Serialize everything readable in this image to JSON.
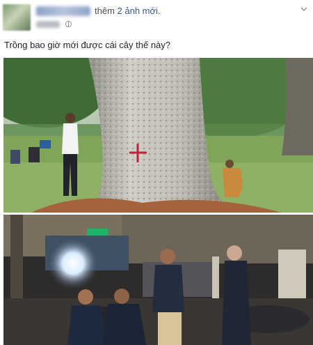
{
  "post": {
    "action_prefix": "thêm",
    "action_link": "2 ảnh mới",
    "action_suffix": ".",
    "caption": "Trồng bao giờ mới được cái cây thế này?"
  },
  "icons": {
    "privacy": "globe-icon",
    "menu": "chevron-down-icon"
  },
  "colors": {
    "link": "#365899",
    "text": "#1d2129",
    "secondary_text": "#90949c"
  }
}
